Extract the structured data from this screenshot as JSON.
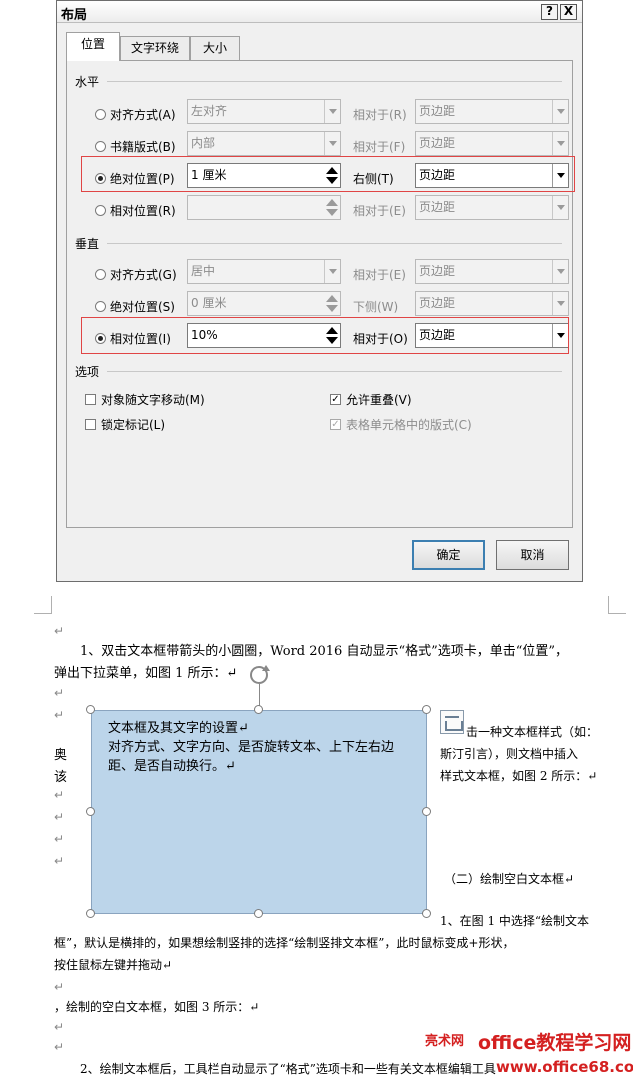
{
  "dialog": {
    "title": "布局",
    "help_button": "?",
    "close_button": "X",
    "tabs": [
      "位置",
      "文字环绕",
      "大小"
    ],
    "horizontal": {
      "section": "水平",
      "rows": [
        {
          "label": "对齐方式(A)",
          "value": "左对齐",
          "rel_label": "相对于(R)",
          "rel_value": "页边距",
          "checked": false
        },
        {
          "label": "书籍版式(B)",
          "value": "内部",
          "rel_label": "相对于(F)",
          "rel_value": "页边距",
          "checked": false
        },
        {
          "label": "绝对位置(P)",
          "value": "1 厘米",
          "rel_label": "右侧(T)",
          "rel_value": "页边距",
          "checked": true
        },
        {
          "label": "相对位置(R)",
          "value": "",
          "rel_label": "相对于(E)",
          "rel_value": "页边距",
          "checked": false
        }
      ]
    },
    "vertical": {
      "section": "垂直",
      "rows": [
        {
          "label": "对齐方式(G)",
          "value": "居中",
          "rel_label": "相对于(E)",
          "rel_value": "页边距",
          "checked": false
        },
        {
          "label": "绝对位置(S)",
          "value": "0 厘米",
          "rel_label": "下侧(W)",
          "rel_value": "页边距",
          "checked": false
        },
        {
          "label": "相对位置(I)",
          "value": "10%",
          "rel_label": "相对于(O)",
          "rel_value": "页边距",
          "checked": true
        }
      ]
    },
    "options": {
      "section": "选项",
      "move_with_text": "对象随文字移动(M)",
      "lock_anchor": "锁定标记(L)",
      "allow_overlap": "允许重叠(V)",
      "layout_in_cell": "表格单元格中的版式(C)"
    },
    "ok": "确定",
    "cancel": "取消"
  },
  "document": {
    "para_mark": "↵",
    "line1": "1、双击文本框带箭头的小圆圈，Word 2016 自动显示“格式”选项卡，单击“位置”，",
    "line2": "弹出下拉菜单，如图 1 所示：↵",
    "textbox_line1": "文本框及其文字的设置↵",
    "textbox_line2": "对齐方式、文字方向、是否旋转文本、上下左右边",
    "textbox_line3": "距、是否自动换行。↵",
    "left_char1": "奥",
    "left_char2": "该",
    "right_line1": "击一种文本框样式（如：",
    "right_line2": "斯汀引言），则文档中插入",
    "right_line3": "样式文本框，如图 2 所示：↵",
    "heading2": "（二）绘制空白文本框↵",
    "right_line4": "1、在图 1 中选择“绘制文本",
    "line3": "框”，默认是横排的，如果想绘制竖排的选择“绘制竖排文本框”，此时鼠标变成+形状，",
    "line4": "按住鼠标左键并拖动↵",
    "line5": "，绘制的空白文本框，如图 3 所示：↵",
    "line6": "2、绘制文本框后，工具栏自动显示了“格式”选项卡和一些有关文本框编辑工具"
  },
  "watermark": {
    "site_cn": "亮术网",
    "site_main": "office教程学习网",
    "site_url": "www.office68.com"
  }
}
